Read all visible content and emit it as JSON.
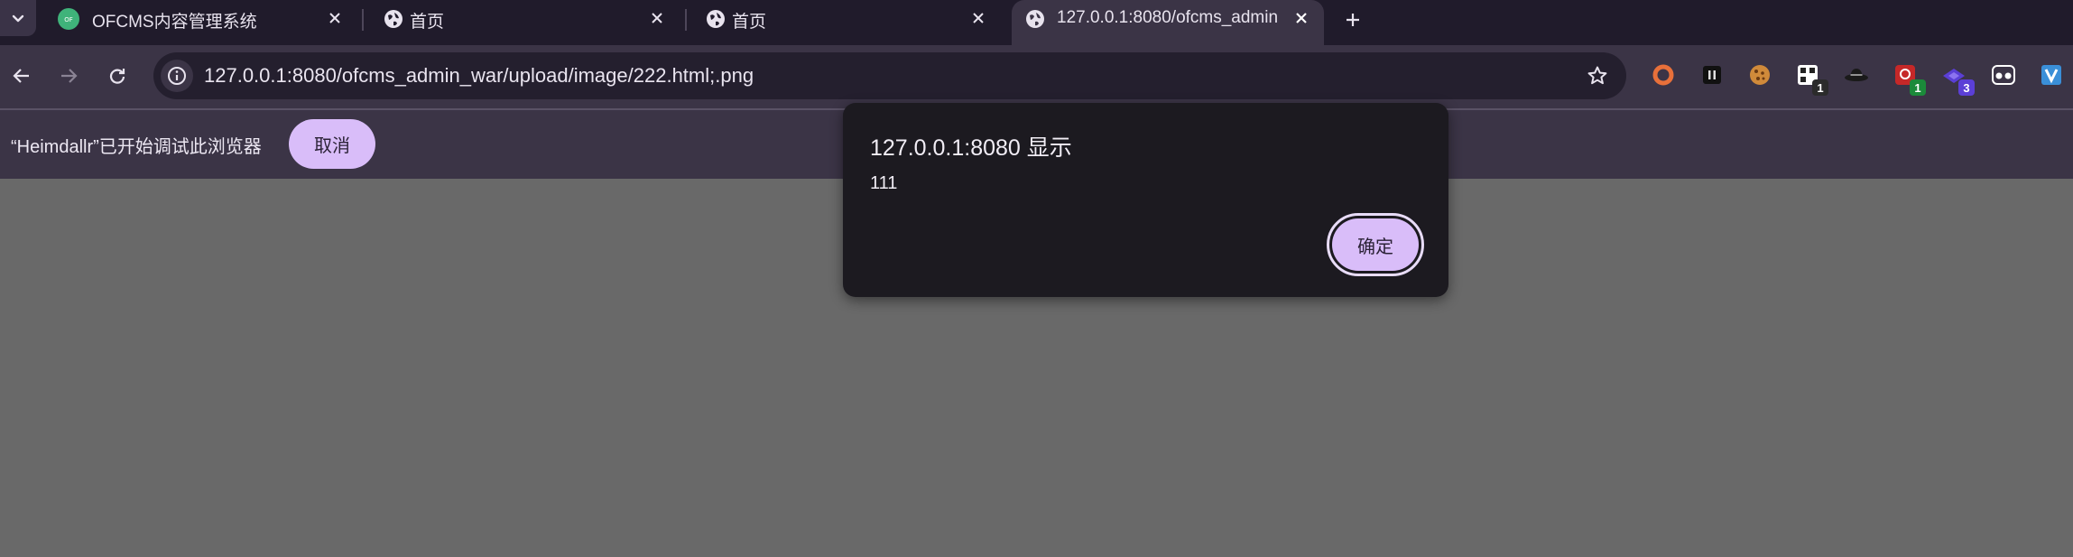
{
  "tabs": [
    {
      "title": "OFCMS内容管理系统",
      "favicon": "ofcms-logo-icon",
      "active": false
    },
    {
      "title": "首页",
      "favicon": "globe-icon",
      "active": false
    },
    {
      "title": "首页",
      "favicon": "globe-icon",
      "active": false
    },
    {
      "title": "127.0.0.1:8080/ofcms_admin",
      "favicon": "globe-icon",
      "active": true
    }
  ],
  "toolbar": {
    "url": "127.0.0.1:8080/ofcms_admin_war/upload/image/222.html;.png",
    "extensions": [
      {
        "icon": "circle-extension-icon",
        "color": "#e8703a",
        "badge": ""
      },
      {
        "icon": "pause-extension-icon",
        "color": "#111111",
        "badge": ""
      },
      {
        "icon": "cookie-extension-icon",
        "color": "#d08a3a",
        "badge": ""
      },
      {
        "icon": "qr-extension-icon",
        "color": "#ffffff",
        "badge": "1",
        "badge_color": "#2b2b2b"
      },
      {
        "icon": "hat-extension-icon",
        "color": "#1a1a1a",
        "badge": ""
      },
      {
        "icon": "red-extension-icon",
        "color": "#c62828",
        "badge": "1",
        "badge_color": "#1b8a3a"
      },
      {
        "icon": "purple-extension-icon",
        "color": "#5b3fd6",
        "badge": "3",
        "badge_color": "#5b3fd6"
      },
      {
        "icon": "glasses-extension-icon",
        "color": "#ffffff",
        "badge": ""
      },
      {
        "icon": "v-extension-icon",
        "color": "#3a8fd8",
        "badge": ""
      }
    ]
  },
  "infobar": {
    "message": "“Heimdallr”已开始调试此浏览器",
    "cancel_label": "取消"
  },
  "dialog": {
    "title": "127.0.0.1:8080 显示",
    "message": "111",
    "ok_label": "确定"
  },
  "colors": {
    "tabstrip": "#201b2b",
    "toolbar": "#3b3446",
    "accent_button": "#d9bdf9",
    "dialog_bg": "#1c1a20",
    "page_bg": "#696969"
  }
}
